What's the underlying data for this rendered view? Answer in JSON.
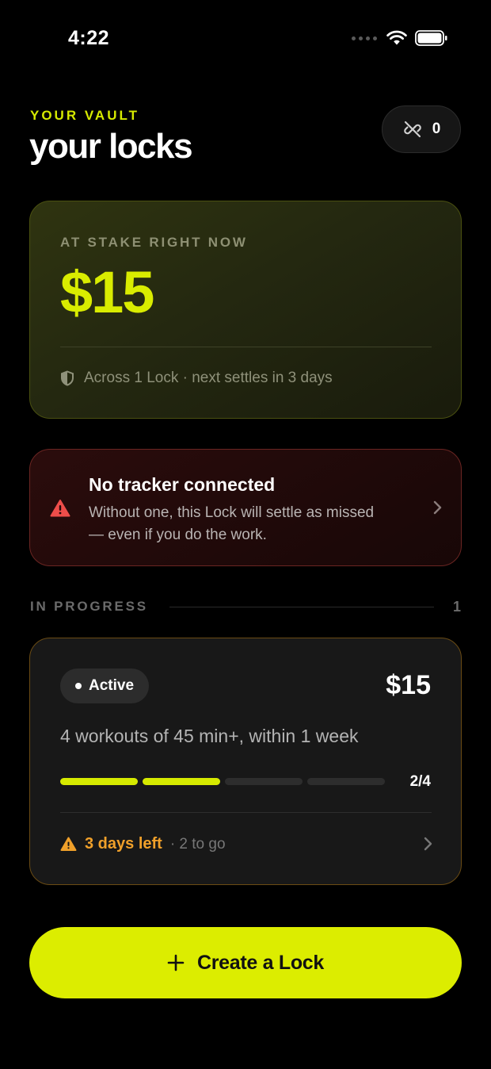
{
  "status_bar": {
    "time": "4:22",
    "icons": [
      "signal-dots-icon",
      "wifi-icon",
      "battery-icon"
    ]
  },
  "header": {
    "eyebrow": "YOUR VAULT",
    "title": "your locks",
    "connections_pill": {
      "icon": "broken-link-icon",
      "count": "0"
    }
  },
  "stake_card": {
    "label": "AT STAKE RIGHT NOW",
    "amount": "$15",
    "footer_icon": "shield-icon",
    "footer_text": "Across 1 Lock · next settles in 3 days"
  },
  "alert": {
    "icon": "warning-icon",
    "title": "No tracker connected",
    "body": "Without one, this Lock will settle as missed — even if you do the work.",
    "chevron": "chevron-right-icon"
  },
  "section": {
    "label": "IN PROGRESS",
    "count": "1"
  },
  "lock": {
    "status": "Active",
    "amount": "$15",
    "goal": "4 workouts of 45 min+, within 1 week",
    "progress": {
      "completed": 2,
      "total": 4,
      "label": "2/4"
    },
    "deadline_icon": "warning-icon",
    "deadline": "3 days left",
    "remaining": "· 2 to go",
    "chevron": "chevron-right-icon"
  },
  "cta": {
    "icon": "plus-icon",
    "label": "Create a Lock"
  },
  "colors": {
    "accent": "#dced00",
    "warning": "#f0a02a",
    "danger": "#e84a4a",
    "background": "#000000"
  }
}
